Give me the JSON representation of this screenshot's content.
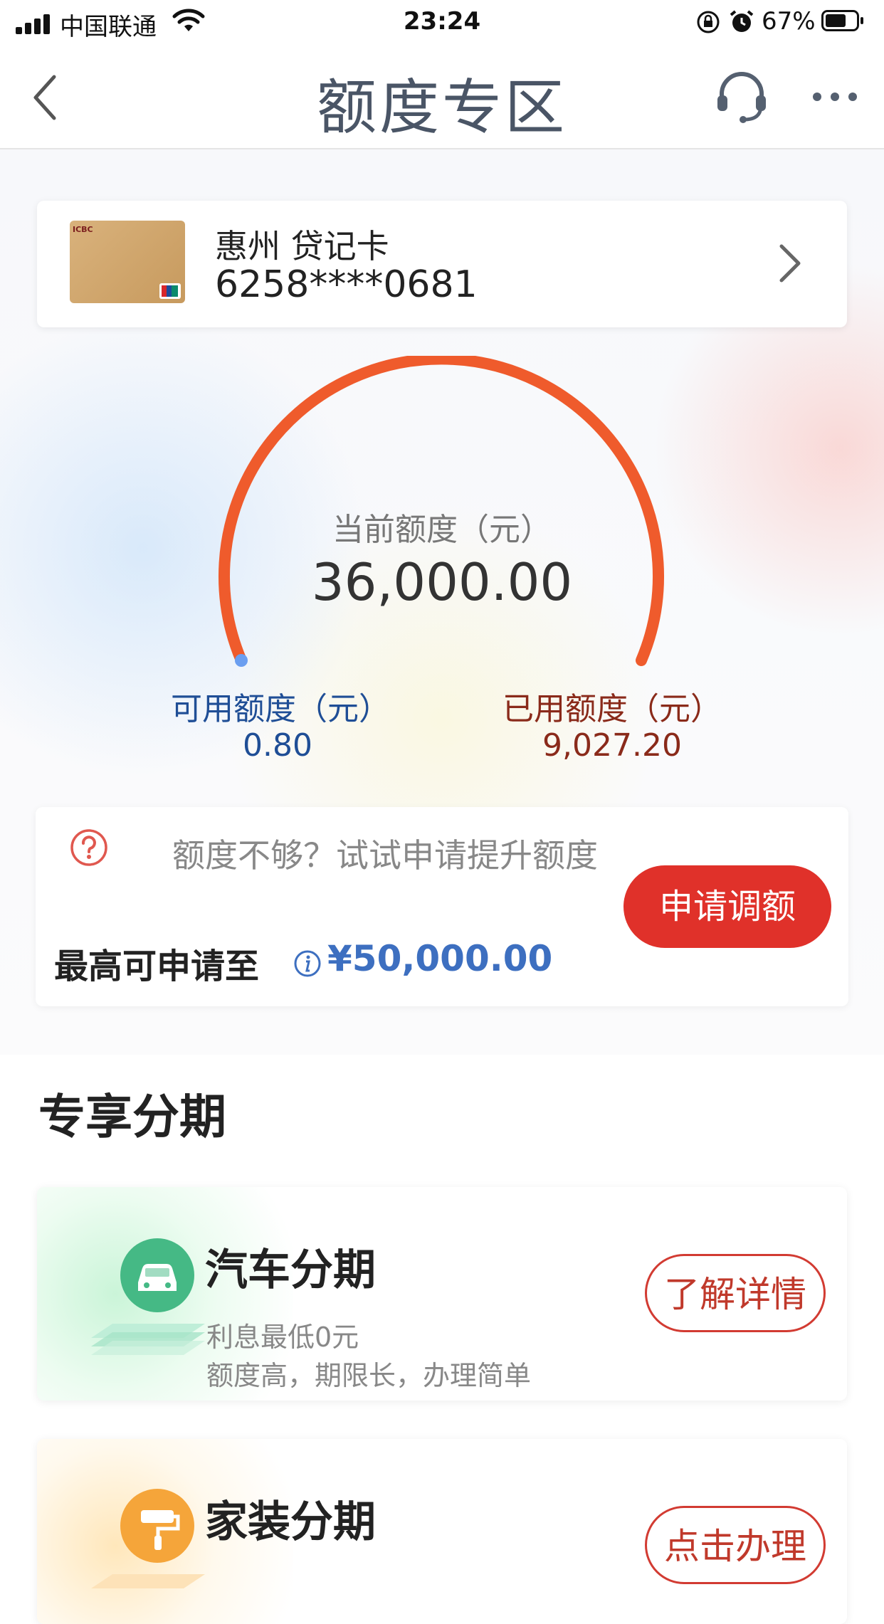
{
  "status_bar": {
    "carrier": "中国联通",
    "time": "23:24",
    "battery": "67%",
    "battery_level": 0.67
  },
  "nav": {
    "title": "额度专区",
    "icons": [
      "back-icon",
      "customer-service-icon",
      "more-icon"
    ]
  },
  "card": {
    "name": "惠州 贷记卡",
    "number": "6258****0681"
  },
  "limit": {
    "current_label": "当前额度（元）",
    "current_value": "36,000.00",
    "available_label": "可用额度（元）",
    "available_value": "0.80",
    "used_label": "已用额度（元）",
    "used_value": "9,027.20",
    "arc_color": "#ef5b2c"
  },
  "upgrade": {
    "prompt": "额度不够？试试申请提升额度",
    "max_label": "最高可申请至",
    "max_value": "¥50,000.00",
    "button": "申请调额",
    "button_color": "#e0312a"
  },
  "installments": {
    "section_title": "专享分期",
    "items": [
      {
        "title": "汽车分期",
        "sub1": "利息最低0元",
        "sub2": "额度高，期限长，办理简单",
        "button": "了解详情",
        "icon": "car-icon"
      },
      {
        "title": "家装分期",
        "button": "点击办理",
        "icon": "paint-roller-icon"
      }
    ]
  }
}
